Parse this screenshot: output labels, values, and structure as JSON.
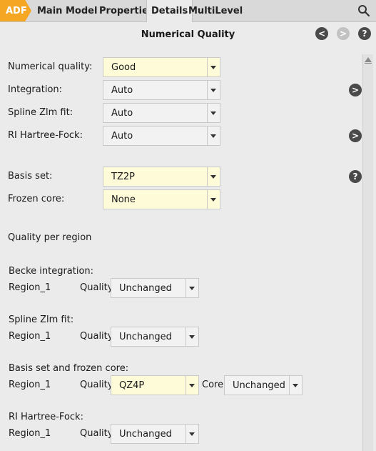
{
  "tabs": {
    "adf": "ADF",
    "main": "Main",
    "model": "Model",
    "properties": "Properties",
    "details": "Details",
    "multilevel": "MultiLevel"
  },
  "panel": {
    "title": "Numerical Quality",
    "back_glyph": "<",
    "forward_glyph": ">",
    "help_glyph": "?",
    "more_glyph": ">"
  },
  "fields": {
    "numerical_quality": {
      "label": "Numerical quality:",
      "value": "Good"
    },
    "integration": {
      "label": "Integration:",
      "value": "Auto"
    },
    "spline_zlm": {
      "label": "Spline Zlm fit:",
      "value": "Auto"
    },
    "ri_hf": {
      "label": "RI Hartree-Fock:",
      "value": "Auto"
    },
    "basis_set": {
      "label": "Basis set:",
      "value": "TZ2P"
    },
    "frozen_core": {
      "label": "Frozen core:",
      "value": "None"
    }
  },
  "regions": {
    "heading": "Quality per region",
    "becke": {
      "heading": "Becke integration:",
      "region": "Region_1",
      "quality_label": "Quality:",
      "quality": "Unchanged"
    },
    "spline": {
      "heading": "Spline Zlm fit:",
      "region": "Region_1",
      "quality_label": "Quality:",
      "quality": "Unchanged"
    },
    "basis": {
      "heading": "Basis set and frozen core:",
      "region": "Region_1",
      "quality_label": "Quality:",
      "quality": "QZ4P",
      "core_label": "Core:",
      "core": "Unchanged"
    },
    "rihf": {
      "heading": "RI Hartree-Fock:",
      "region": "Region_1",
      "quality_label": "Quality:",
      "quality": "Unchanged"
    }
  },
  "colors": {
    "accent": "#f5a623",
    "highlight_field": "#fdfbd8"
  }
}
